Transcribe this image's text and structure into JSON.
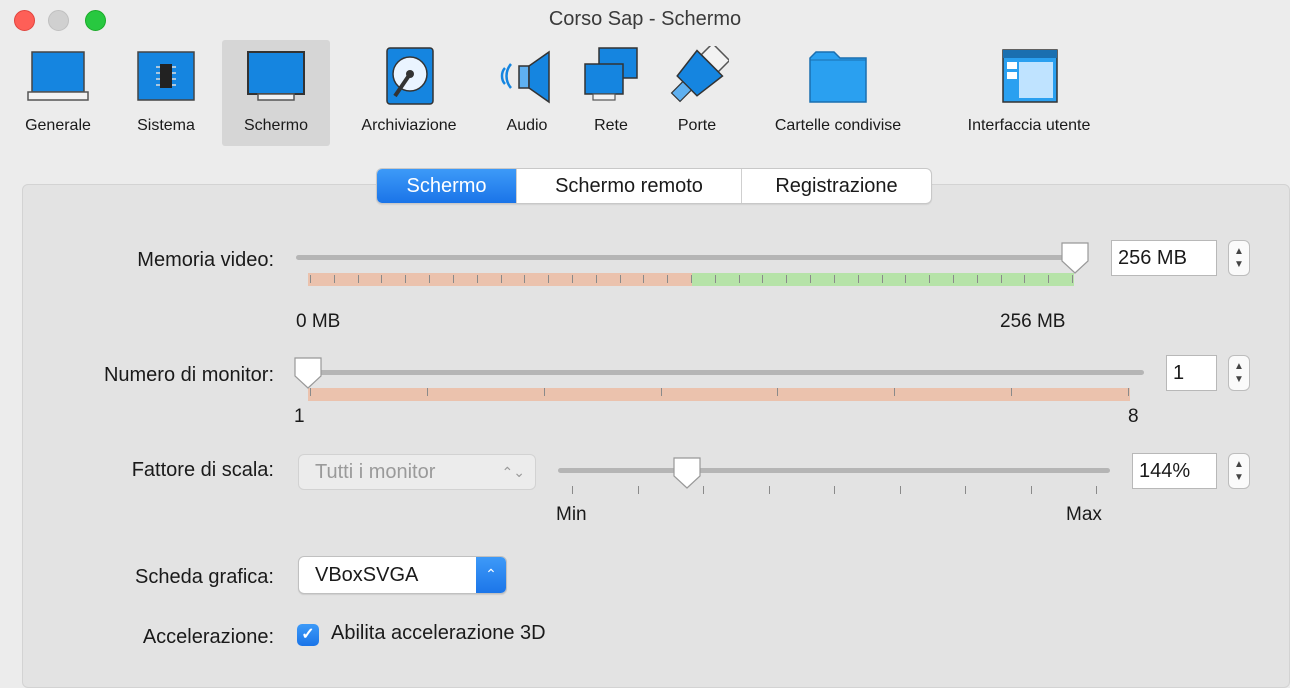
{
  "window": {
    "title": "Corso Sap - Schermo"
  },
  "toolbar": {
    "items": [
      {
        "label": "Generale",
        "icon": "monitor-general-icon"
      },
      {
        "label": "Sistema",
        "icon": "chip-icon"
      },
      {
        "label": "Schermo",
        "icon": "display-icon",
        "active": true
      },
      {
        "label": "Archiviazione",
        "icon": "disk-icon"
      },
      {
        "label": "Audio",
        "icon": "speaker-icon"
      },
      {
        "label": "Rete",
        "icon": "network-icon"
      },
      {
        "label": "Porte",
        "icon": "ports-icon"
      },
      {
        "label": "Cartelle condivise",
        "icon": "folder-icon"
      },
      {
        "label": "Interfaccia utente",
        "icon": "window-icon"
      }
    ]
  },
  "tabs": [
    {
      "label": "Schermo",
      "active": true
    },
    {
      "label": "Schermo remoto",
      "active": false
    },
    {
      "label": "Registrazione",
      "active": false
    }
  ],
  "video_memory": {
    "label": "Memoria video:",
    "value": "256 MB",
    "min_label": "0 MB",
    "max_label": "256 MB",
    "level": 1.0
  },
  "monitors": {
    "label": "Numero di monitor:",
    "value": "1",
    "min_label": "1",
    "max_label": "8",
    "level": 0.0
  },
  "scale": {
    "label": "Fattore di scala:",
    "combo_value": "Tutti i monitor",
    "value": "144%",
    "min_label": "Min",
    "max_label": "Max",
    "level": 0.23
  },
  "graphics": {
    "label": "Scheda grafica:",
    "value": "VBoxSVGA"
  },
  "acceleration": {
    "label": "Accelerazione:",
    "checkbox_label": "Abilita accelerazione 3D",
    "checked": true
  },
  "colors": {
    "accent": "#1a74e8",
    "warn_band": "#ebc2ad",
    "ok_band": "#b6e3a8"
  }
}
